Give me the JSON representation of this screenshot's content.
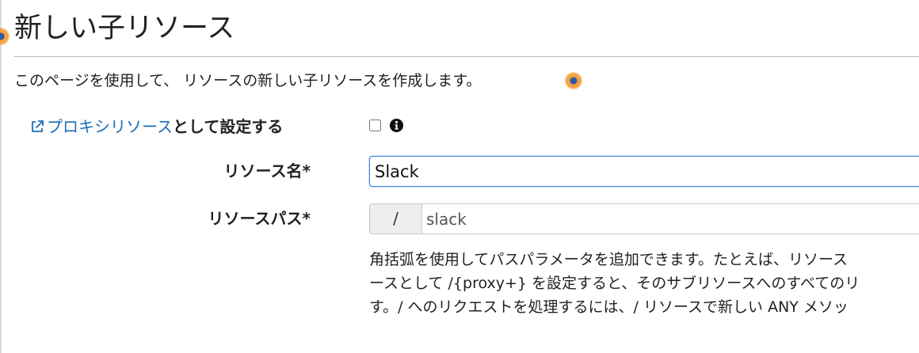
{
  "page": {
    "title": "新しい子リソース",
    "description": "このページを使用して、 リソースの新しい子リソースを作成します。"
  },
  "proxy": {
    "link_text": "プロキシリソース",
    "suffix_text": "として設定する",
    "checked": false
  },
  "form": {
    "resource_name_label": "リソース名*",
    "resource_name_value": "Slack",
    "resource_path_label": "リソースパス*",
    "resource_path_prefix": "/",
    "resource_path_value": "slack"
  },
  "help": {
    "lines": [
      "角括弧を使用してパスパラメータを追加できます。たとえば、リソース",
      "ースとして /{proxy+} を設定すると、そのサブリソースへのすべてのリ",
      "す。/ へのリクエストを処理するには、/ リソースで新しい ANY メソッ"
    ]
  },
  "icons": {
    "external_link": "external-link-icon",
    "info": "info-icon"
  },
  "colors": {
    "link": "#1a6eb8",
    "input_focus_border": "#3f86d9",
    "hotspot": "#f3a340"
  }
}
